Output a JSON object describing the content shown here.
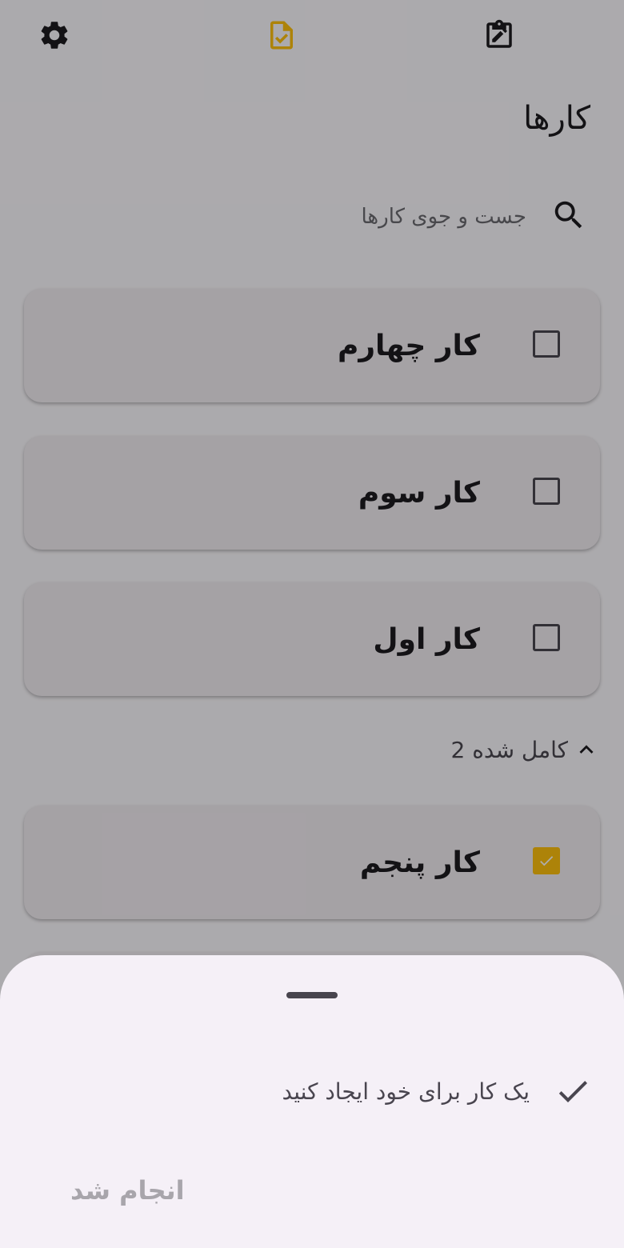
{
  "header": {
    "title": "کارها",
    "icons": {
      "settings": "gear-icon",
      "tasks": "task-document-check-icon",
      "notes": "clipboard-edit-icon"
    },
    "accent_color": "#ffc20e"
  },
  "search": {
    "placeholder": "جست و جوی کارها",
    "value": ""
  },
  "tasks": [
    {
      "label": "کار چهارم",
      "checked": false
    },
    {
      "label": "کار سوم",
      "checked": false
    },
    {
      "label": "کار اول",
      "checked": false
    }
  ],
  "completed": {
    "label": "کامل شده 2",
    "expanded": true,
    "items": [
      {
        "label": "کار پنجم",
        "checked": true
      }
    ]
  },
  "bottom_sheet": {
    "option_label": "یک کار برای خود ایجاد کنید",
    "option_icon": "check-icon",
    "done_label": "انجام شد"
  }
}
